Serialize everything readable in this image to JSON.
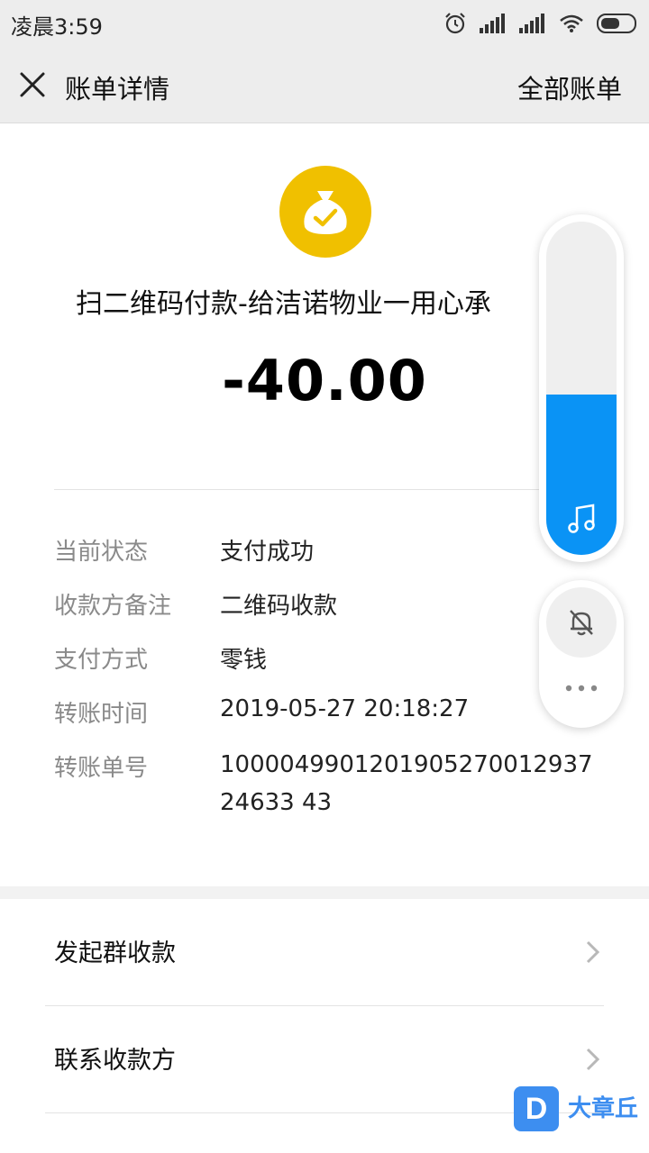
{
  "status_bar": {
    "time": "凌晨3:59"
  },
  "nav": {
    "title": "账单详情",
    "right_link": "全部账单"
  },
  "header": {
    "description": "扫二维码付款-给洁诺物业一用心承",
    "amount": "-40.00",
    "icon": "money-bag-check-icon",
    "icon_color": "#f0c000"
  },
  "details": [
    {
      "label": "当前状态",
      "value": "支付成功"
    },
    {
      "label": "收款方备注",
      "value": "二维码收款"
    },
    {
      "label": "支付方式",
      "value": "零钱"
    },
    {
      "label": "转账时间",
      "value": "2019-05-27 20:18:27"
    },
    {
      "label": "转账单号",
      "value": "100004990120190527001293724633 43"
    }
  ],
  "actions": [
    {
      "label": "发起群收款"
    },
    {
      "label": "联系收款方"
    }
  ],
  "volume": {
    "level_percent": 48,
    "accent": "#0a93f5"
  },
  "watermark": {
    "logo_letter": "D",
    "text": "大章丘"
  }
}
